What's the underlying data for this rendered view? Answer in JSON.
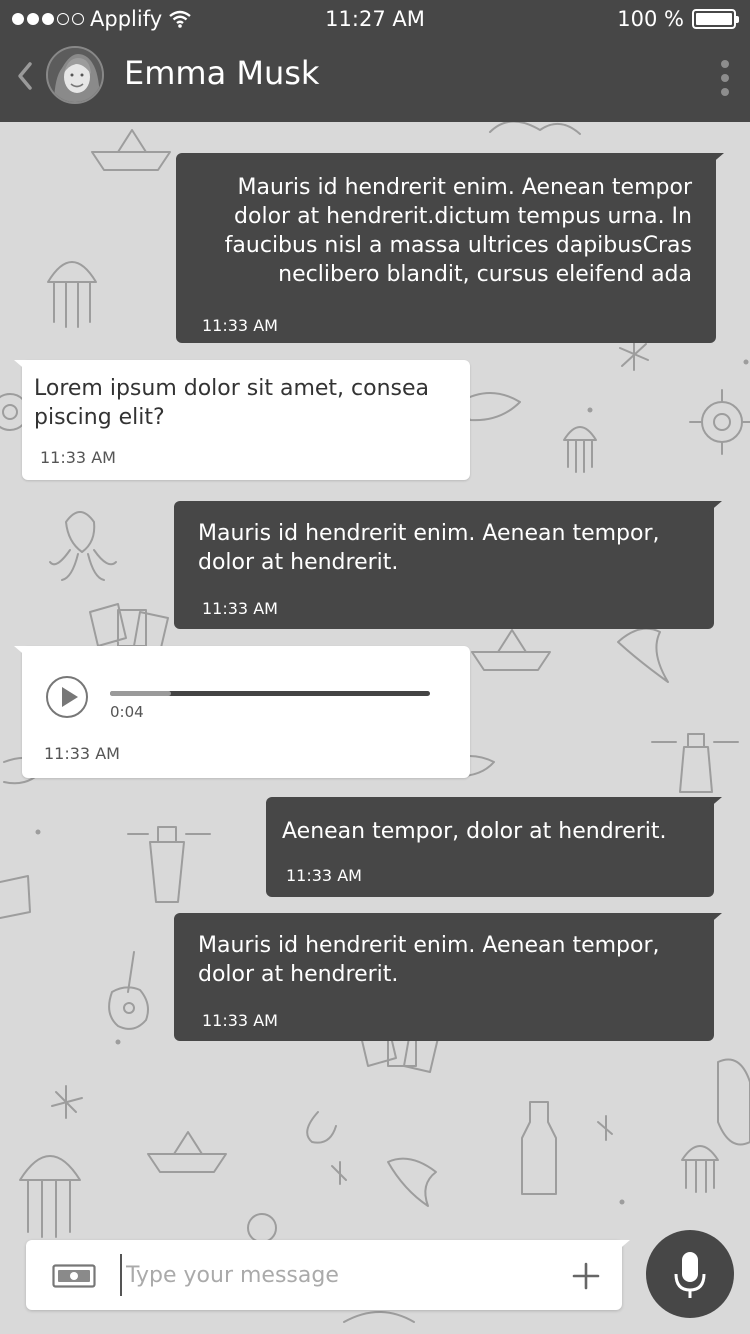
{
  "status_bar": {
    "carrier": "Applify",
    "time": "11:27 AM",
    "battery": "100 %"
  },
  "header": {
    "contact_name": "Emma Musk"
  },
  "messages": [
    {
      "direction": "out",
      "text": "Mauris id hendrerit enim. Aenean tempor dolor at hendrerit.dictum tempus urna. In faucibus nisl a massa ultrices dapibusCras neclibero blandit, cursus eleifend ada",
      "time": "11:33 AM"
    },
    {
      "direction": "in",
      "text": "Lorem ipsum dolor sit amet, consea piscing elit?",
      "time": "11:33 AM"
    },
    {
      "direction": "out",
      "text": "Mauris id hendrerit enim. Aenean tempor, dolor at hendrerit.",
      "time": "11:33 AM"
    },
    {
      "direction": "in",
      "type": "audio",
      "duration": "0:04",
      "progress": 0.19,
      "time": "11:33 AM"
    },
    {
      "direction": "out",
      "text": "Aenean tempor, dolor at hendrerit.",
      "time": "11:33 AM"
    },
    {
      "direction": "out",
      "text": "Mauris id hendrerit enim. Aenean tempor, dolor at hendrerit.",
      "time": "11:33 AM"
    }
  ],
  "composer": {
    "placeholder": "Type your message"
  },
  "colors": {
    "bar": "#474747",
    "background": "#d9d9d9",
    "incoming": "#ffffff"
  }
}
